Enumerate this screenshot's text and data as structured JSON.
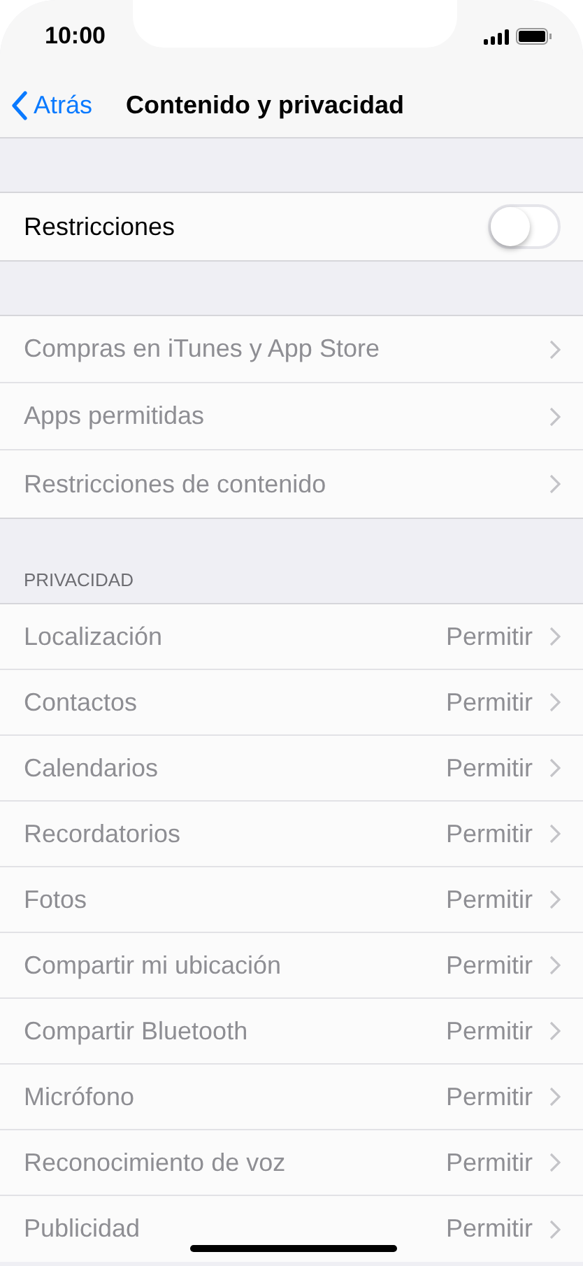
{
  "status_bar": {
    "time": "10:00"
  },
  "nav": {
    "back": "Atrás",
    "title": "Contenido y privacidad"
  },
  "toggle_row": {
    "label": "Restricciones",
    "on": false
  },
  "links": [
    {
      "label": "Compras en iTunes y App Store",
      "disabled": true
    },
    {
      "label": "Apps permitidas",
      "disabled": true
    },
    {
      "label": "Restricciones de contenido",
      "disabled": true
    }
  ],
  "privacy": {
    "header": "PRIVACIDAD",
    "rows": [
      {
        "label": "Localización",
        "value": "Permitir",
        "disabled": true
      },
      {
        "label": "Contactos",
        "value": "Permitir",
        "disabled": true
      },
      {
        "label": "Calendarios",
        "value": "Permitir",
        "disabled": true
      },
      {
        "label": "Recordatorios",
        "value": "Permitir",
        "disabled": true
      },
      {
        "label": "Fotos",
        "value": "Permitir",
        "disabled": true
      },
      {
        "label": "Compartir mi ubicación",
        "value": "Permitir",
        "disabled": true
      },
      {
        "label": "Compartir Bluetooth",
        "value": "Permitir",
        "disabled": true
      },
      {
        "label": "Micrófono",
        "value": "Permitir",
        "disabled": true
      },
      {
        "label": "Reconocimiento de voz",
        "value": "Permitir",
        "disabled": true
      },
      {
        "label": "Publicidad",
        "value": "Permitir",
        "disabled": true
      }
    ]
  }
}
